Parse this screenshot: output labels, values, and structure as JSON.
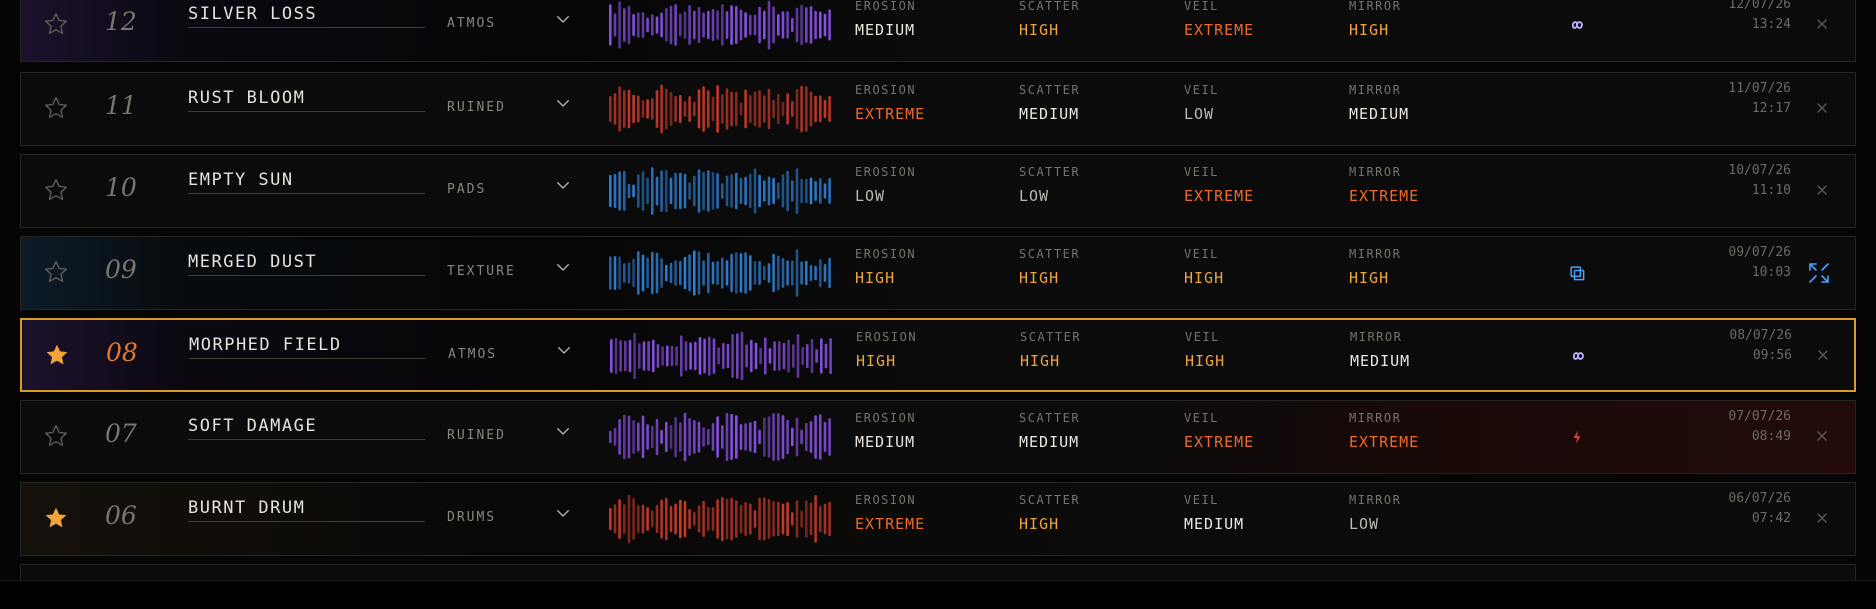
{
  "param_labels": [
    "EROSION",
    "SCATTER",
    "VEIL",
    "MIRROR"
  ],
  "colors": {
    "accent_selected": "#d99a2b",
    "star_active": "#f0a43a",
    "level_low": "#bdb9b0",
    "level_medium": "#ebe7df",
    "level_high": "#f0a43a",
    "level_extreme": "#ee6a2a",
    "wave_purple": "#8a52e8",
    "wave_red": "#c93a2a",
    "wave_blue": "#2f7fd4"
  },
  "rows": [
    {
      "number": "12",
      "name": "SILVER LOSS",
      "category": "ATMOS",
      "starred": false,
      "selected": false,
      "wave_color": "purple",
      "tint": "purple",
      "params": [
        "MEDIUM",
        "HIGH",
        "EXTREME",
        "HIGH"
      ],
      "mode_icon": "infinity-icon",
      "date": "12/07/26",
      "time": "13:24",
      "action_icon": "close-icon"
    },
    {
      "number": "11",
      "name": "RUST BLOOM",
      "category": "RUINED",
      "starred": false,
      "selected": false,
      "wave_color": "red",
      "tint": "none",
      "params": [
        "EXTREME",
        "MEDIUM",
        "LOW",
        "MEDIUM"
      ],
      "mode_icon": "",
      "date": "11/07/26",
      "time": "12:17",
      "action_icon": "close-icon"
    },
    {
      "number": "10",
      "name": "EMPTY SUN",
      "category": "PADS",
      "starred": false,
      "selected": false,
      "wave_color": "blue",
      "tint": "none",
      "params": [
        "LOW",
        "LOW",
        "EXTREME",
        "EXTREME"
      ],
      "mode_icon": "",
      "date": "10/07/26",
      "time": "11:10",
      "action_icon": "close-icon"
    },
    {
      "number": "09",
      "name": "MERGED DUST",
      "category": "TEXTURE",
      "starred": false,
      "selected": false,
      "wave_color": "blue",
      "tint": "blue",
      "params": [
        "HIGH",
        "HIGH",
        "HIGH",
        "HIGH"
      ],
      "mode_icon": "layers-icon",
      "date": "09/07/26",
      "time": "10:03",
      "action_icon": "expand-icon"
    },
    {
      "number": "08",
      "name": "MORPHED FIELD",
      "category": "ATMOS",
      "starred": true,
      "selected": true,
      "wave_color": "purple",
      "tint": "purple",
      "params": [
        "HIGH",
        "HIGH",
        "HIGH",
        "MEDIUM"
      ],
      "mode_icon": "infinity-icon",
      "date": "08/07/26",
      "time": "09:56",
      "action_icon": "close-icon"
    },
    {
      "number": "07",
      "name": "SOFT DAMAGE",
      "category": "RUINED",
      "starred": false,
      "selected": false,
      "wave_color": "purple",
      "tint": "red-right",
      "params": [
        "MEDIUM",
        "MEDIUM",
        "EXTREME",
        "EXTREME"
      ],
      "mode_icon": "bolt-icon",
      "date": "07/07/26",
      "time": "08:49",
      "action_icon": "close-icon"
    },
    {
      "number": "06",
      "name": "BURNT DRUM",
      "category": "DRUMS",
      "starred": true,
      "selected": false,
      "wave_color": "red",
      "tint": "warm",
      "params": [
        "EXTREME",
        "HIGH",
        "MEDIUM",
        "LOW"
      ],
      "mode_icon": "",
      "date": "06/07/26",
      "time": "07:42",
      "action_icon": "close-icon"
    }
  ]
}
